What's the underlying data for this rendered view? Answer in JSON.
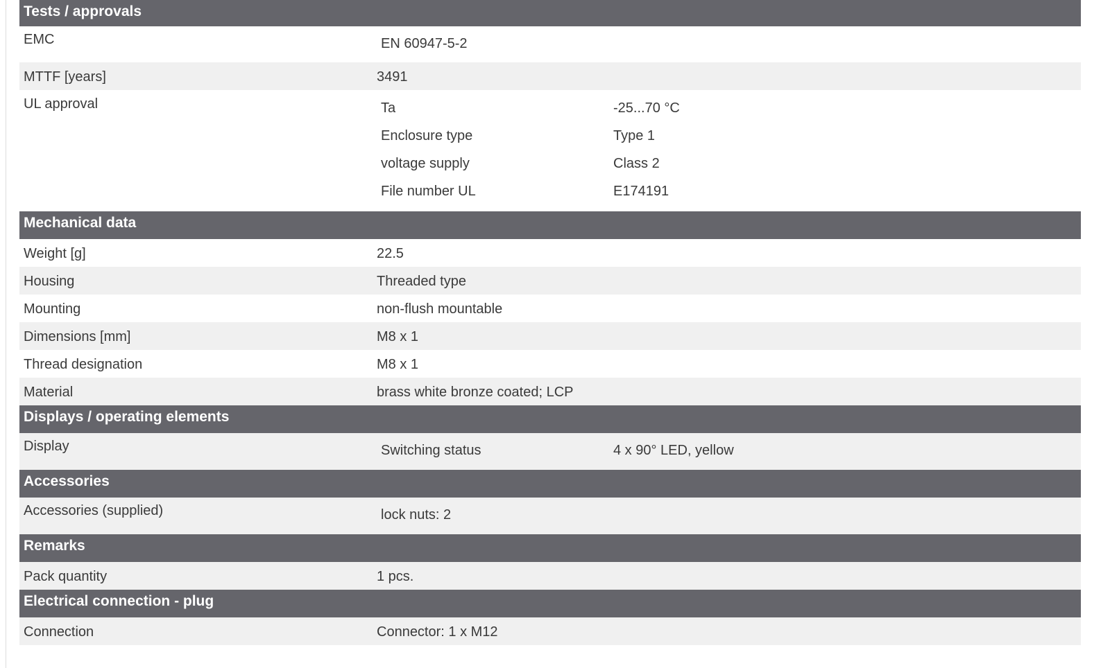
{
  "sections": [
    {
      "title": "Tests / approvals",
      "rows": [
        {
          "label": "EMC",
          "value": "EN 60947-5-2"
        },
        {
          "label": "MTTF [years]",
          "value": "3491"
        },
        {
          "label": "UL approval",
          "nested": [
            {
              "label": "Ta",
              "value": "-25...70 °C"
            },
            {
              "label": "Enclosure type",
              "value": "Type 1"
            },
            {
              "label": "voltage supply",
              "value": "Class 2"
            },
            {
              "label": "File number UL",
              "value": "E174191"
            }
          ]
        }
      ]
    },
    {
      "title": "Mechanical data",
      "rows": [
        {
          "label": "Weight [g]",
          "value": "22.5"
        },
        {
          "label": "Housing",
          "value": "Threaded type"
        },
        {
          "label": "Mounting",
          "value": "non-flush mountable"
        },
        {
          "label": "Dimensions [mm]",
          "value": "M8 x 1"
        },
        {
          "label": "Thread designation",
          "value": "M8 x 1"
        },
        {
          "label": "Material",
          "value": "brass white bronze coated; LCP"
        }
      ]
    },
    {
      "title": "Displays / operating elements",
      "rows": [
        {
          "label": "Display",
          "nested": [
            {
              "label": "Switching status",
              "value": "4 x 90° LED, yellow"
            }
          ]
        }
      ]
    },
    {
      "title": "Accessories",
      "rows": [
        {
          "label": "Accessories (supplied)",
          "nested": [
            {
              "label": "lock nuts: 2"
            }
          ]
        }
      ]
    },
    {
      "title": "Remarks",
      "rows": [
        {
          "label": "Pack quantity",
          "value": "1 pcs."
        }
      ]
    },
    {
      "title": "Electrical connection - plug",
      "rows": [
        {
          "label": "Connection",
          "value": "Connector: 1 x M12"
        }
      ]
    }
  ],
  "colors": {
    "section_header_bg": "#65656b",
    "section_header_text": "#ffffff",
    "row_alt_bg": "#f0f0f0",
    "text": "#3a3a3a"
  }
}
